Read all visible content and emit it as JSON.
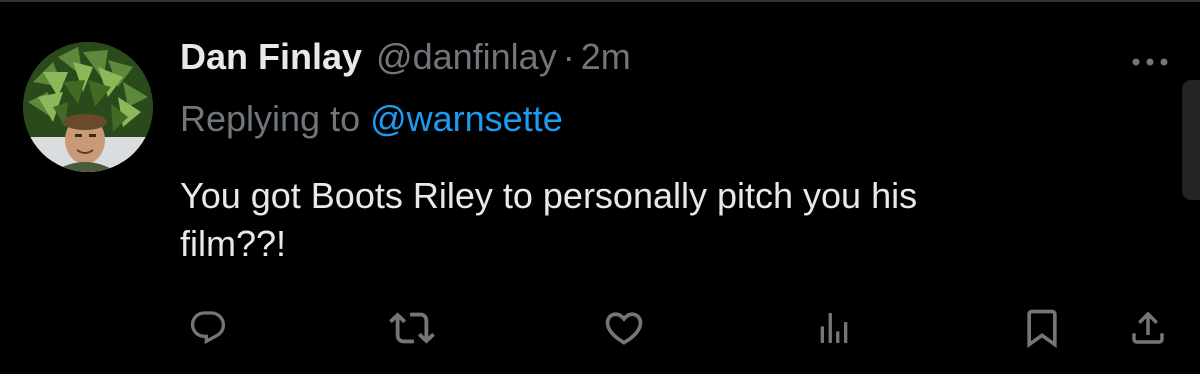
{
  "tweet": {
    "display_name": "Dan Finlay",
    "handle": "@danfinlay",
    "separator": "·",
    "time": "2m",
    "reply_prefix": "Replying to ",
    "reply_mention": "@warnsette",
    "text_line1": "You got Boots Riley to personally pitch you his",
    "text_line2": "film??!"
  },
  "actions": [
    "reply-icon",
    "retweet-icon",
    "like-icon",
    "views-icon",
    "bookmark-icon",
    "share-icon"
  ],
  "colors": {
    "background": "#000000",
    "primary_text": "#e7e9ea",
    "secondary_text": "#71767b",
    "accent": "#1d9bf0"
  }
}
